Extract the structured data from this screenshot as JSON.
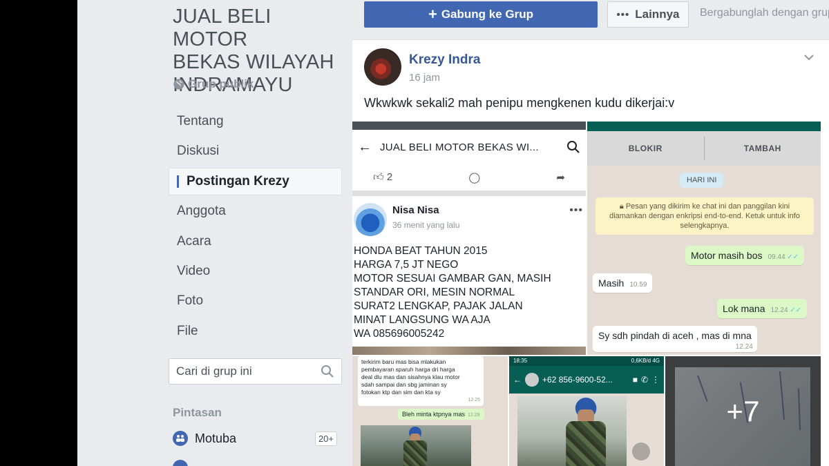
{
  "group": {
    "title_lines": [
      "JUAL BELI MOTOR",
      "BEKAS WILAYAH",
      "INDRAMAYU"
    ],
    "type": "Grup publik"
  },
  "nav": [
    {
      "label": "Tentang"
    },
    {
      "label": "Diskusi"
    },
    {
      "label": "Postingan Krezy",
      "active": true
    },
    {
      "label": "Anggota"
    },
    {
      "label": "Acara"
    },
    {
      "label": "Video"
    },
    {
      "label": "Foto"
    },
    {
      "label": "File"
    }
  ],
  "search": {
    "placeholder": "Cari di grup ini"
  },
  "shortcuts": {
    "title": "Pintasan",
    "items": [
      {
        "label": "Motuba",
        "badge": "20+"
      },
      {
        "label": "",
        "badge": ""
      }
    ]
  },
  "topbar": {
    "join_label": "Gabung ke Grup",
    "more_label": "Lainnya",
    "hint": "Bergabunglah dengan grup"
  },
  "post": {
    "author": "Krezy Indra",
    "time": "16 jam",
    "text": "Wkwkwk sekali2 mah penipu mengkenen kudu dikerjai:v"
  },
  "photo1": {
    "header_title": "JUAL BELI MOTOR BEKAS WI...",
    "like_count": "2",
    "name": "Nisa Nisa",
    "time": "36 menit yang lalu",
    "body": [
      "HONDA BEAT TAHUN 2015",
      "HARGA 7,5 JT NEGO",
      "MOTOR SESUAI GAMBAR GAN, MASIH",
      "STANDAR ORI, MESIN NORMAL",
      "SURAT2 LENGKAP, PAJAK JALAN",
      "MINAT LANGSUNG WA AJA",
      "WA 085696005242"
    ]
  },
  "photo2": {
    "action_block": "BLOKIR",
    "action_add": "TAMBAH",
    "day": "HARI INI",
    "notice": "Pesan yang dikirim ke chat ini dan panggilan kini diamankan dengan enkripsi end-to-end. Ketuk untuk info selengkapnya.",
    "messages": [
      {
        "text": "Motor masih bos",
        "time": "09.44",
        "out": true
      },
      {
        "text": "Masih",
        "time": "10.59",
        "out": false
      },
      {
        "text": "Lok mana",
        "time": "12.24",
        "out": true
      },
      {
        "text": "Sy sdh pindah di aceh , mas di mna",
        "time": "12.24",
        "out": false
      }
    ]
  },
  "photo3": {
    "chat_lines": [
      "terkirim baru mas bisa mlakukan",
      "pembayaran sparuh harga dri harga",
      "deal dlu mas dan sisahnya klau motor",
      "sdah sampai dan sbg jaminan sy",
      "fotokan ktp dan sim dan kta sy"
    ],
    "chat_time": "12.25",
    "out_text": "Bleh minta ktpnya mas",
    "out_time": "12.29"
  },
  "photo4": {
    "status_time": "18:35",
    "status_right": "0,6KB/d 4G",
    "number": "+62 856-9600-52..."
  },
  "photo5": {
    "more_count": "+7"
  },
  "colors": {
    "fb_blue": "#4267b2",
    "link_blue": "#365899",
    "wa_green": "#075e54",
    "wa_out_bubble": "#dcf8c6",
    "page_bg": "#e9ebee"
  }
}
